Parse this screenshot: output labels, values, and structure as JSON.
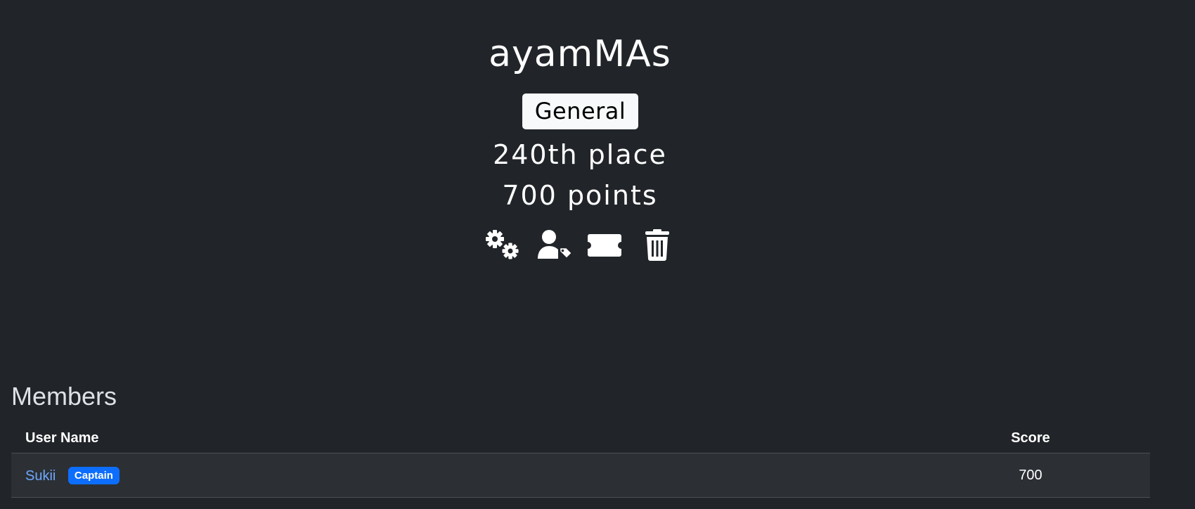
{
  "team": {
    "name": "ayamMAs",
    "bracket": "General",
    "place": "240th place",
    "points": "700 points"
  },
  "admin_actions": [
    {
      "icon": "gears-icon",
      "label": "Edit team"
    },
    {
      "icon": "user-tag-icon",
      "label": "Choose captain"
    },
    {
      "icon": "ticket-icon",
      "label": "Award"
    },
    {
      "icon": "trash-icon",
      "label": "Delete team"
    }
  ],
  "members": {
    "title": "Members",
    "columns": {
      "user_name": "User Name",
      "score": "Score"
    },
    "rows": [
      {
        "name": "Sukii",
        "badge": "Captain",
        "score": "700"
      }
    ]
  },
  "colors": {
    "background": "#212529",
    "row_background": "#2c3034",
    "link": "#6ea8fe",
    "captain_badge": "#0d6efd",
    "bracket_badge": "#f8f9fa"
  }
}
